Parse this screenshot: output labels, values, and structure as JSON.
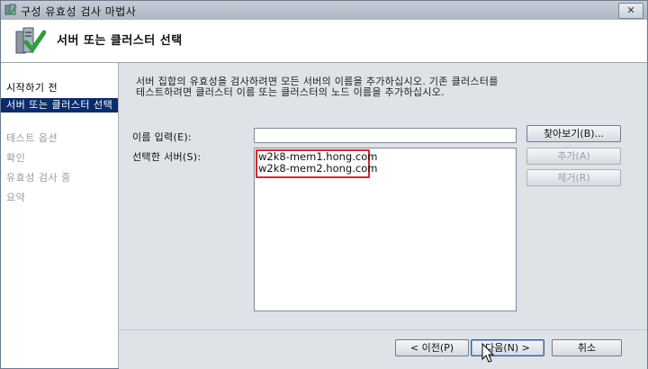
{
  "window": {
    "title": "구성 유효성 검사 마법사",
    "close_label": "✕"
  },
  "header": {
    "title": "서버 또는 클러스터 선택"
  },
  "sidebar": {
    "items": [
      {
        "label": "시작하기 전",
        "state": "normal"
      },
      {
        "label": "서버 또는 클러스터 선택",
        "state": "active"
      },
      {
        "label": "테스트 옵션",
        "state": "disabled"
      },
      {
        "label": "확인",
        "state": "disabled"
      },
      {
        "label": "유효성 검사 중",
        "state": "disabled"
      },
      {
        "label": "요약",
        "state": "disabled"
      }
    ]
  },
  "main": {
    "description_line1": "서버 집합의 유효성을 검사하려면 모든 서버의 이름을 추가하십시오. 기존 클러스터를",
    "description_line2": "테스트하려면 클러스터 이름 또는 클러스터의 노드 이름을 추가하십시오.",
    "name_label": "이름 입력(E):",
    "name_value": "",
    "selected_label": "선택한 서버(S):",
    "selected_servers": [
      "w2k8-mem1.hong.com",
      "w2k8-mem2.hong.com"
    ],
    "browse_label": "찾아보기(B)...",
    "add_label": "추가(A)",
    "remove_label": "제거(R)"
  },
  "footer": {
    "prev_label": "< 이전(P)",
    "next_label": "다음(N) >",
    "cancel_label": "취소"
  },
  "colors": {
    "active_nav": "#0a2c6b",
    "highlight_box": "#d8262c"
  }
}
